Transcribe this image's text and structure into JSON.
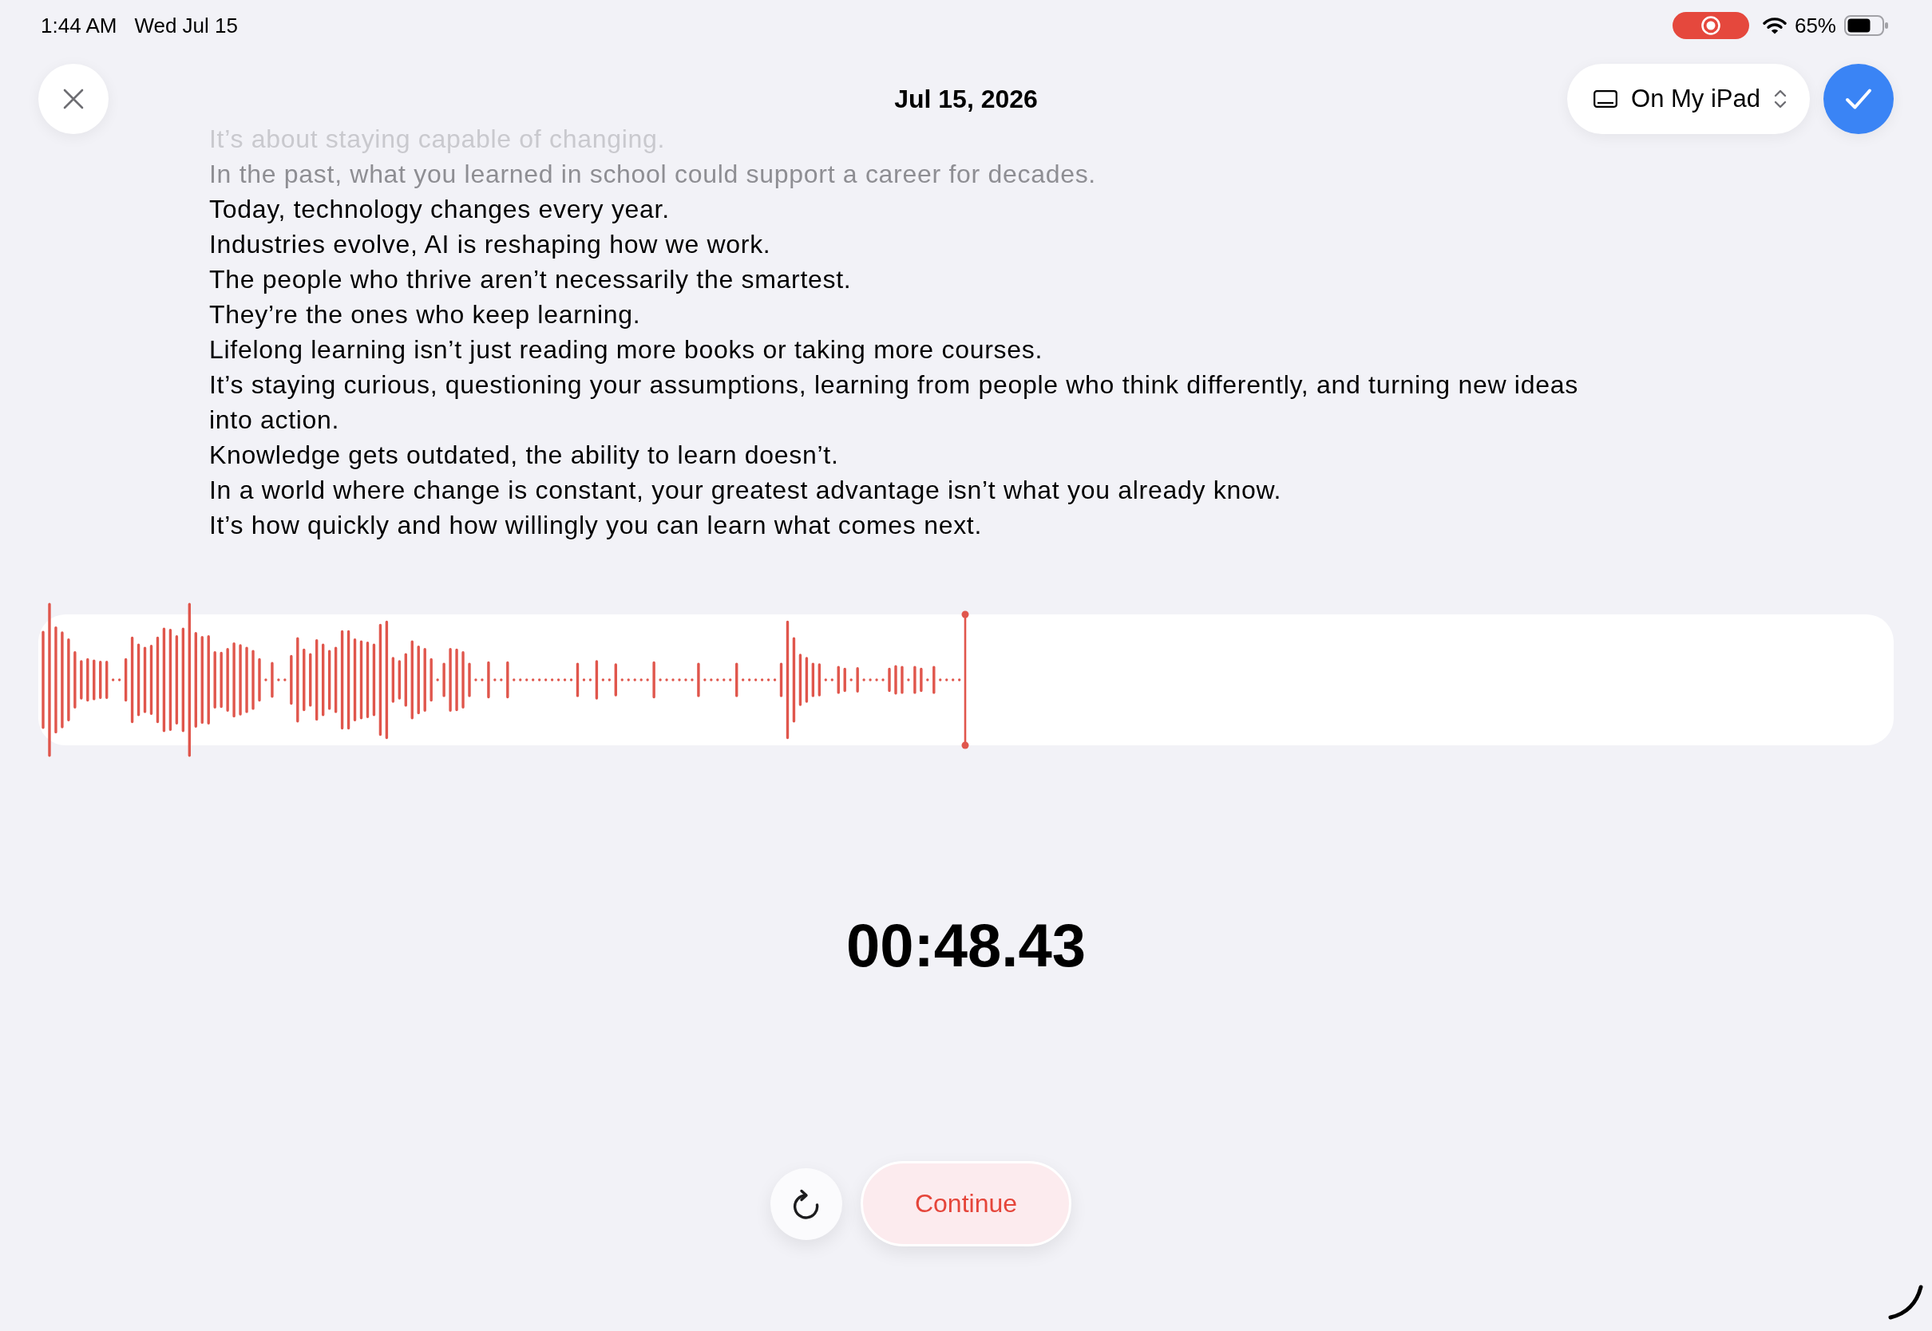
{
  "status_bar": {
    "time": "1:44 AM",
    "date": "Wed Jul 15",
    "screen_recording": true,
    "battery": "65%"
  },
  "header": {
    "title": "Jul 15, 2026",
    "location": "On My iPad"
  },
  "transcript": {
    "lines": [
      {
        "text": "It’s about staying capable of changing.",
        "kind": "faint"
      },
      {
        "text": "In the past, what you learned in school could support a career for decades.",
        "kind": "dim"
      },
      {
        "text": "Today, technology changes every year.",
        "kind": "plain"
      },
      {
        "text": "Industries evolve, AI is reshaping how we work.",
        "kind": "plain"
      },
      {
        "text": "The people who thrive aren’t necessarily the smartest.",
        "kind": "plain"
      },
      {
        "text": "They’re the ones who keep learning.",
        "kind": "plain"
      },
      {
        "text": "Lifelong learning isn’t just reading more books or taking more courses.",
        "kind": "plain"
      },
      {
        "text": "It’s staying curious, questioning your assumptions, learning from people who think differently, and turning new ideas into action.",
        "kind": "plain"
      },
      {
        "text": "Knowledge gets outdated, the ability to learn doesn’t.",
        "kind": "plain"
      },
      {
        "text": "In a world where change is constant, your greatest advantage isn’t what you already know.",
        "kind": "plain"
      },
      {
        "text": "It’s how quickly and how willingly you can learn what comes next.",
        "kind": "plain"
      }
    ]
  },
  "recorder": {
    "elapsed": "00:48.43"
  },
  "continue_button": {
    "label": "Continue"
  }
}
